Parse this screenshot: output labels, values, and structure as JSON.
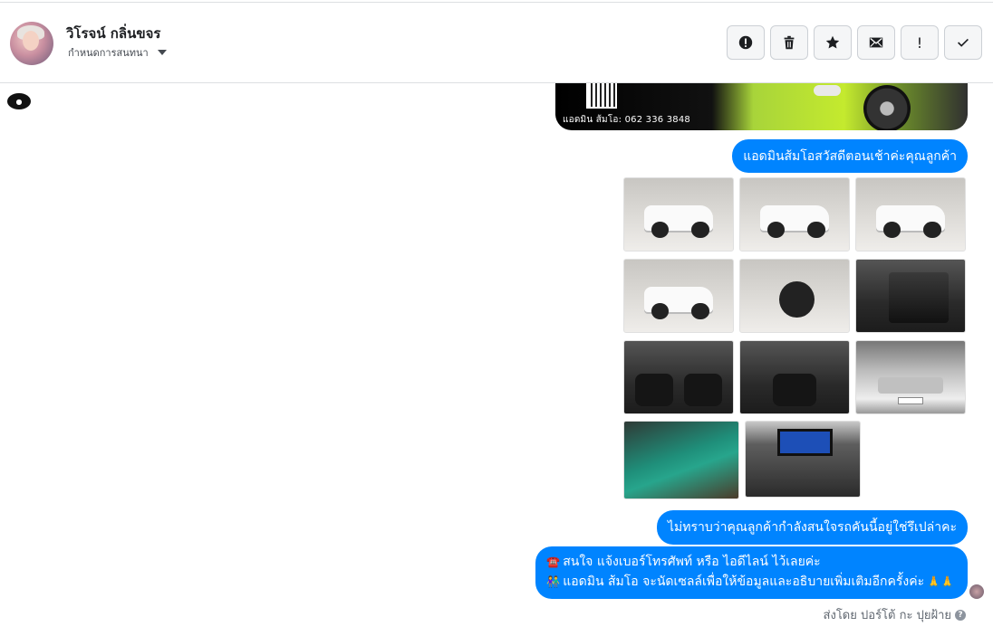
{
  "header": {
    "contact_name": "วิโรจน์ กลิ่นขจร",
    "assign_label": "กำหนดการสนทนา",
    "actions": [
      {
        "name": "spam-button",
        "icon": "alert-circle-icon",
        "glyph": "!"
      },
      {
        "name": "delete-button",
        "icon": "trash-icon",
        "glyph": "🗑"
      },
      {
        "name": "star-button",
        "icon": "star-icon",
        "glyph": "★"
      },
      {
        "name": "mark-unread-button",
        "icon": "envelope-icon",
        "glyph": "✉"
      },
      {
        "name": "flag-button",
        "icon": "exclamation-icon",
        "glyph": "!"
      },
      {
        "name": "done-button",
        "icon": "check-icon",
        "glyph": "✓"
      }
    ]
  },
  "thread": {
    "banner_text": "แอดมิน ส้มโอ: 062 336 3848",
    "messages": {
      "greeting": "แอดมินส้มโอสวัสดีตอนเช้าค่ะคุณลูกค้า",
      "question": "ไม่ทราบว่าคุณลูกค้ากำลังสนใจรถคันนี้อยู่ใช่รึเปล่าคะ",
      "offer_line1": "สนใจ แจ้งเบอร์โทรศัพท์ หรือ ไอดีไลน์  ไว้เลยค่ะ",
      "offer_line2": "แอดมิน ส้มโอ จะนัดเซลล์เพื่อให้ข้อมูลและอธิบายเพิ่มเติมอีกครั้งค่ะ",
      "emoji_phone": "☎️",
      "emoji_people": "👫",
      "emoji_pray": "🙏🙏"
    },
    "sent_by": "ส่งโดย ปอร์โต้ กะ ปุยฝ้าย",
    "help_glyph": "?"
  },
  "colors": {
    "bubble": "#0084ff",
    "border": "#dddfe2"
  }
}
